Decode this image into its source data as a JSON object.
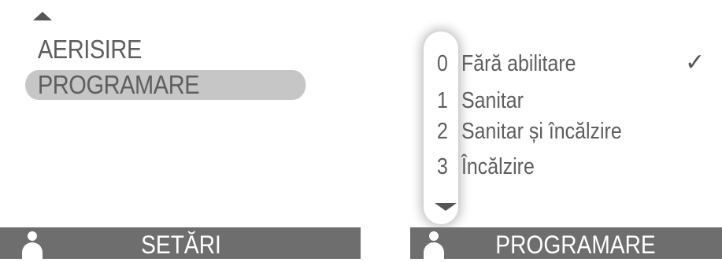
{
  "left": {
    "icons": {
      "scroll_up": "arrow-up-icon",
      "user": "user-icon"
    },
    "menu": [
      {
        "label": "AERISIRE",
        "selected": false
      },
      {
        "label": "PROGRAMARE",
        "selected": true
      }
    ],
    "status_title": "SETĂRI"
  },
  "right": {
    "icons": {
      "scroll_down": "arrow-down-icon",
      "check": "check-icon",
      "user": "user-icon"
    },
    "options": [
      {
        "num": "0",
        "label": "Fără abilitare",
        "checked": true
      },
      {
        "num": "1",
        "label": "Sanitar",
        "checked": false
      },
      {
        "num": "2",
        "label": "Sanitar și încălzire",
        "checked": false
      },
      {
        "num": "3",
        "label": "Încălzire",
        "checked": false
      }
    ],
    "check_glyph": "✓",
    "status_title": "PROGRAMARE"
  },
  "colors": {
    "statusbar_bg": "#6e6e6e",
    "selection_bg": "#c6c6c6",
    "text": "#5e5e5e"
  }
}
